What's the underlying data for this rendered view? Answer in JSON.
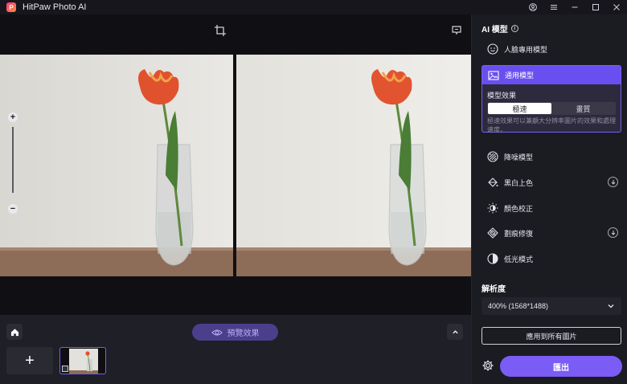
{
  "app": {
    "title": "HitPaw Photo AI"
  },
  "panel": {
    "title": "AI 模型",
    "models": [
      {
        "label": "人臉專用模型"
      },
      {
        "label": "通用模型"
      },
      {
        "label": "降噪模型"
      },
      {
        "label": "黑白上色"
      },
      {
        "label": "顏色校正"
      },
      {
        "label": "劃痕修復"
      },
      {
        "label": "低光模式"
      }
    ],
    "active": {
      "effect_label": "模型效果",
      "options": [
        "極速",
        "畫質"
      ],
      "selected": "極速",
      "description": "極速效果可以兼顧大分辨率圖片的效果和處理速度。"
    },
    "resolution": {
      "title": "解析度",
      "value": "400% (1568*1488)"
    },
    "apply_label": "應用到所有圖片",
    "export_label": "匯出"
  },
  "bottom": {
    "preview_label": "預覽效果",
    "add_label": "+"
  },
  "zoom": {
    "plus": "+",
    "minus": "−"
  },
  "colors": {
    "accent": "#7b5cf5",
    "accent_dark": "#6a4ff0",
    "preview_bg": "#4b3f8c"
  }
}
